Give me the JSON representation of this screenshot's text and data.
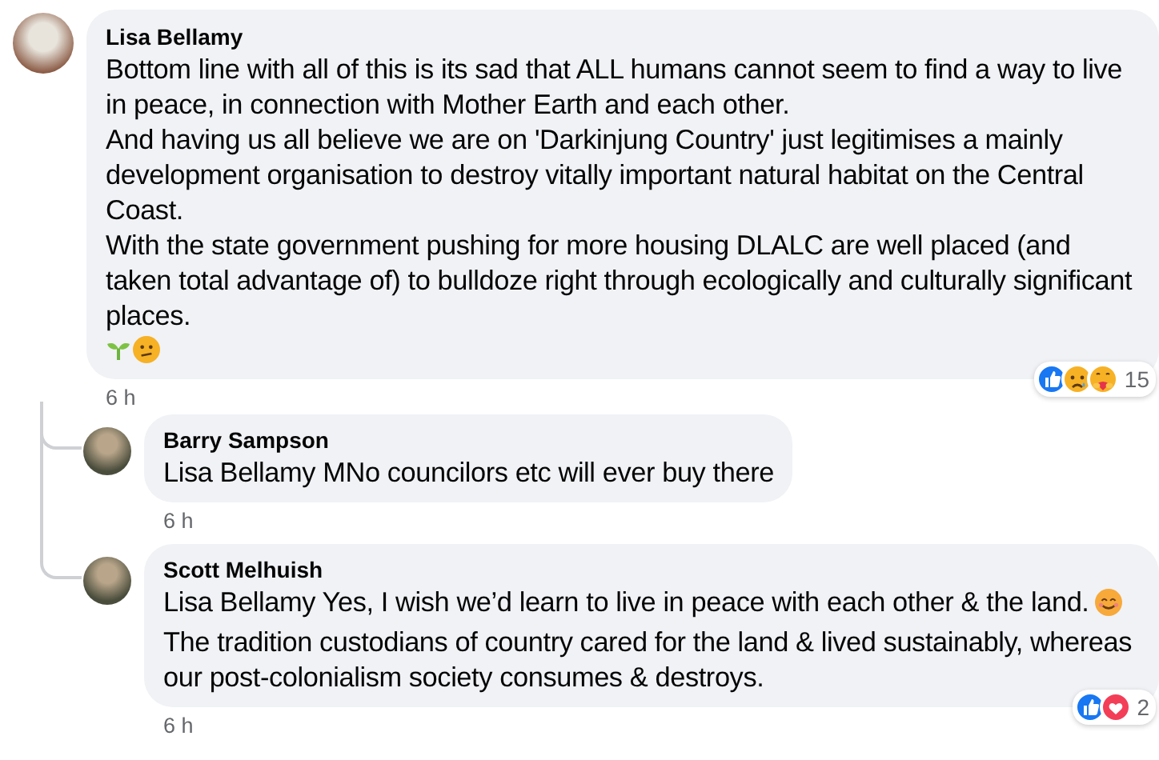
{
  "comments": [
    {
      "author": "Lisa Bellamy",
      "paragraphs": [
        "Bottom line with all of this is its sad that ALL humans cannot seem to find a way to live in peace, in connection with Mother Earth and each other.",
        "And having us all believe we are on 'Darkinjung Country' just legitimises a mainly development organisation to destroy vitally important natural habitat on the Central Coast.",
        "With the state government pushing for more housing DLALC are well placed (and taken total advantage of) to bulldoze right through ecologically and culturally significant places."
      ],
      "time": "6 h",
      "reactions": [
        {
          "kind": "like"
        },
        {
          "kind": "sad"
        },
        {
          "kind": "care"
        }
      ],
      "reaction_count": "15",
      "replies": [
        {
          "author": "Barry Sampson",
          "paragraphs": [
            "Lisa Bellamy MNo councilors etc will ever buy there"
          ],
          "time": "6 h"
        },
        {
          "author": "Scott Melhuish",
          "paragraphs": [
            "Lisa Bellamy Yes, I wish we’d learn to live in peace with each other & the land.",
            "The tradition custodians of country cared for the land & lived sustainably, whereas our post-colonialism society consumes & destroys."
          ],
          "time": "6 h",
          "reactions": [
            {
              "kind": "like"
            },
            {
              "kind": "love"
            }
          ],
          "reaction_count": "2"
        }
      ]
    }
  ]
}
